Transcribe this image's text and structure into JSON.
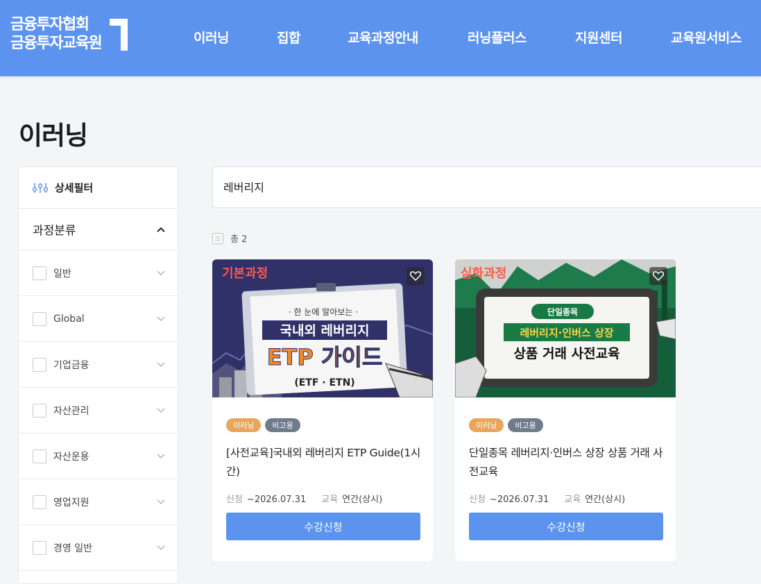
{
  "header": {
    "logo_line1": "금융투자협회",
    "logo_line2": "금융투자교육원",
    "nav": [
      "이러닝",
      "집합",
      "교육과정안내",
      "러닝플러스",
      "지원센터",
      "교육원서비스"
    ]
  },
  "page_title": "이러닝",
  "sidebar": {
    "filter_label": "상세필터",
    "category_label": "과정분류",
    "items": [
      "일반",
      "Global",
      "기업금융",
      "자산관리",
      "자산운용",
      "영업지원",
      "경영 일반"
    ]
  },
  "search": {
    "value": "레버리지"
  },
  "result_count": "총 2",
  "cards": [
    {
      "thumb": {
        "tag": "기본과정",
        "sub": "· 한 눈에 알아보는 ·",
        "line1": "국내외 레버리지",
        "line2": "ETP 가이드",
        "line3": "(ETF · ETN)"
      },
      "badges": [
        "이러닝",
        "비고용"
      ],
      "title": "[사전교육]국내외 레버리지 ETP Guide(1시간)",
      "apply_label": "신청",
      "apply_value": "~2026.07.31",
      "edu_label": "교육",
      "edu_value": "연간(상시)",
      "button": "수강신청"
    },
    {
      "thumb": {
        "tag": "심화과정",
        "sub": "단일종목",
        "line1": "레버리지·인버스 상장",
        "line2": "상품 거래 사전교육"
      },
      "badges": [
        "이러닝",
        "비고용"
      ],
      "title": "단일종목 레버리지·인버스 상장 상품 거래 사전교육",
      "apply_label": "신청",
      "apply_value": "~2026.07.31",
      "edu_label": "교육",
      "edu_value": "연간(상시)",
      "button": "수강신청"
    }
  ],
  "colors": {
    "header": "#5b93ef",
    "button": "#5b93ef",
    "badge_orange": "#e8a55c",
    "badge_gray": "#6f7a8c"
  }
}
